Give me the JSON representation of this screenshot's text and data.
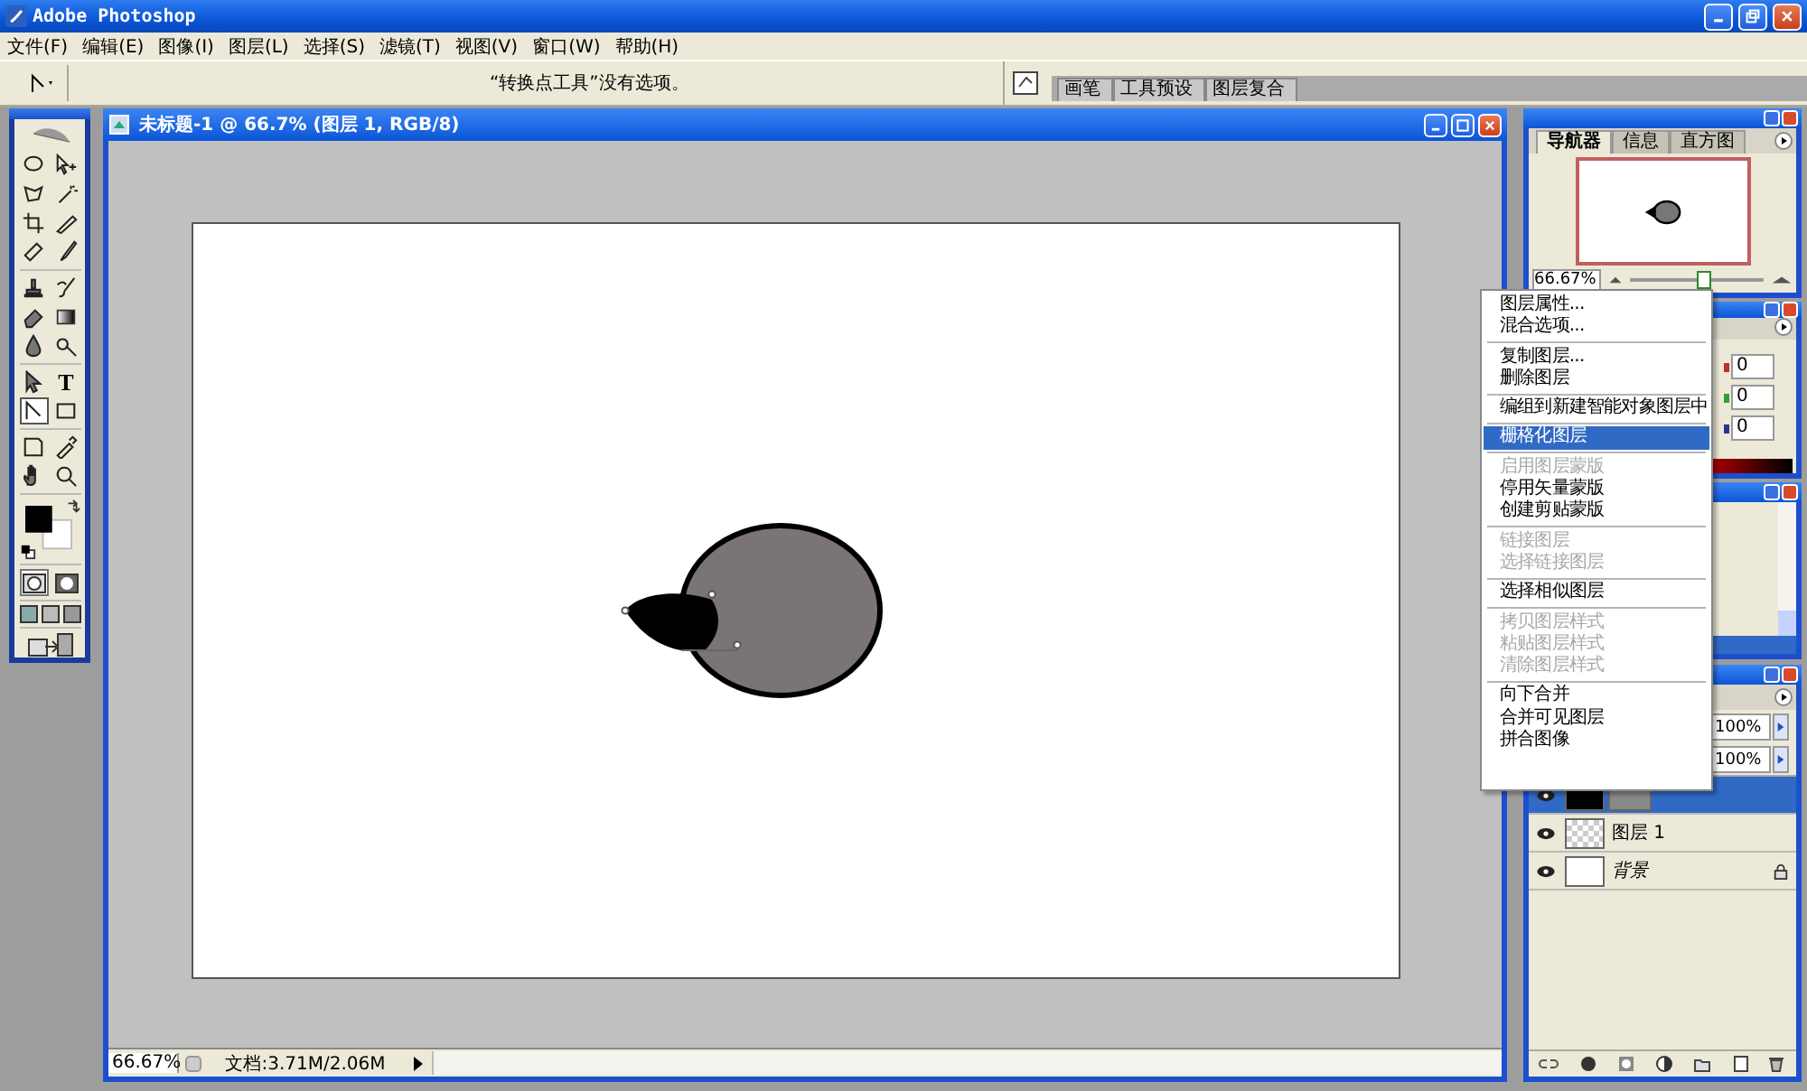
{
  "window": {
    "title": "Adobe Photoshop"
  },
  "menu_bar": [
    "文件(F)",
    "编辑(E)",
    "图像(I)",
    "图层(L)",
    "选择(S)",
    "滤镜(T)",
    "视图(V)",
    "窗口(W)",
    "帮助(H)"
  ],
  "options_bar": {
    "message": "“转换点工具”没有选项。"
  },
  "palette_well": [
    {
      "label": "画笔"
    },
    {
      "label": "工具预设"
    },
    {
      "label": "图层复合"
    }
  ],
  "toolbox": {
    "tools": [
      {
        "kind": "marquee",
        "selected": false
      },
      {
        "kind": "move",
        "selected": false
      },
      {
        "kind": "lasso",
        "selected": false
      },
      {
        "kind": "wand",
        "selected": false
      },
      {
        "kind": "crop",
        "selected": false
      },
      {
        "kind": "slice",
        "selected": false
      },
      {
        "kind": "heal",
        "selected": false
      },
      {
        "kind": "brush",
        "selected": false
      },
      {
        "kind": "stamp",
        "selected": false
      },
      {
        "kind": "history",
        "selected": false
      },
      {
        "kind": "eraser",
        "selected": false
      },
      {
        "kind": "gradient",
        "selected": false
      },
      {
        "kind": "blur",
        "selected": false
      },
      {
        "kind": "dodge",
        "selected": false
      },
      {
        "kind": "select",
        "selected": false
      },
      {
        "kind": "type",
        "glyph": "T",
        "selected": false
      },
      {
        "kind": "pen",
        "selected": true
      },
      {
        "kind": "shape",
        "selected": false
      },
      {
        "kind": "notes",
        "selected": false
      },
      {
        "kind": "eyedropper",
        "selected": false
      },
      {
        "kind": "hand",
        "selected": false
      },
      {
        "kind": "zoom",
        "selected": false
      }
    ]
  },
  "document": {
    "title": "未标题-1 @ 66.7% (图层 1, RGB/8)",
    "zoom": "66.67%",
    "doc_info": "文档:3.71M/2.06M"
  },
  "navigator": {
    "tabs": [
      {
        "label": "导航器",
        "selected": true
      },
      {
        "label": "信息",
        "selected": false
      },
      {
        "label": "直方图",
        "selected": false
      }
    ],
    "zoom": "66.67%",
    "level": 0.55
  },
  "color_panel": {
    "channels": [
      {
        "value": "0",
        "color": "#c03030"
      },
      {
        "value": "0",
        "color": "#30a030"
      },
      {
        "value": "0",
        "color": "#303090"
      }
    ]
  },
  "layers_panel": {
    "opacity": "100%",
    "fill": "100%",
    "layers": [
      {
        "kind": "shape",
        "selected": true,
        "visible": true,
        "locked": false
      },
      {
        "kind": "pixel",
        "name": "图层 1",
        "selected": false,
        "visible": true,
        "locked": false
      },
      {
        "kind": "background",
        "name": "背景",
        "selected": false,
        "visible": true,
        "locked": true
      }
    ]
  },
  "context_menu": {
    "groups": [
      [
        {
          "label": "图层属性...",
          "disabled": false,
          "selected": false
        },
        {
          "label": "混合选项...",
          "disabled": false,
          "selected": false
        }
      ],
      [
        {
          "label": "复制图层...",
          "disabled": false,
          "selected": false
        },
        {
          "label": "删除图层",
          "disabled": false,
          "selected": false
        }
      ],
      [
        {
          "label": "编组到新建智能对象图层中",
          "disabled": false,
          "selected": false
        }
      ],
      [
        {
          "label": "栅格化图层",
          "disabled": false,
          "selected": true
        }
      ],
      [
        {
          "label": "启用图层蒙版",
          "disabled": true,
          "selected": false
        },
        {
          "label": "停用矢量蒙版",
          "disabled": false,
          "selected": false
        },
        {
          "label": "创建剪贴蒙版",
          "disabled": false,
          "selected": false
        }
      ],
      [
        {
          "label": "链接图层",
          "disabled": true,
          "selected": false
        },
        {
          "label": "选择链接图层",
          "disabled": true,
          "selected": false
        }
      ],
      [
        {
          "label": "选择相似图层",
          "disabled": false,
          "selected": false
        }
      ],
      [
        {
          "label": "拷贝图层样式",
          "disabled": true,
          "selected": false
        },
        {
          "label": "粘贴图层样式",
          "disabled": true,
          "selected": false
        },
        {
          "label": "清除图层样式",
          "disabled": true,
          "selected": false
        }
      ],
      [
        {
          "label": "向下合并",
          "disabled": false,
          "selected": false
        },
        {
          "label": "合并可见图层",
          "disabled": false,
          "selected": false
        },
        {
          "label": "拼合图像",
          "disabled": false,
          "selected": false
        }
      ]
    ]
  }
}
